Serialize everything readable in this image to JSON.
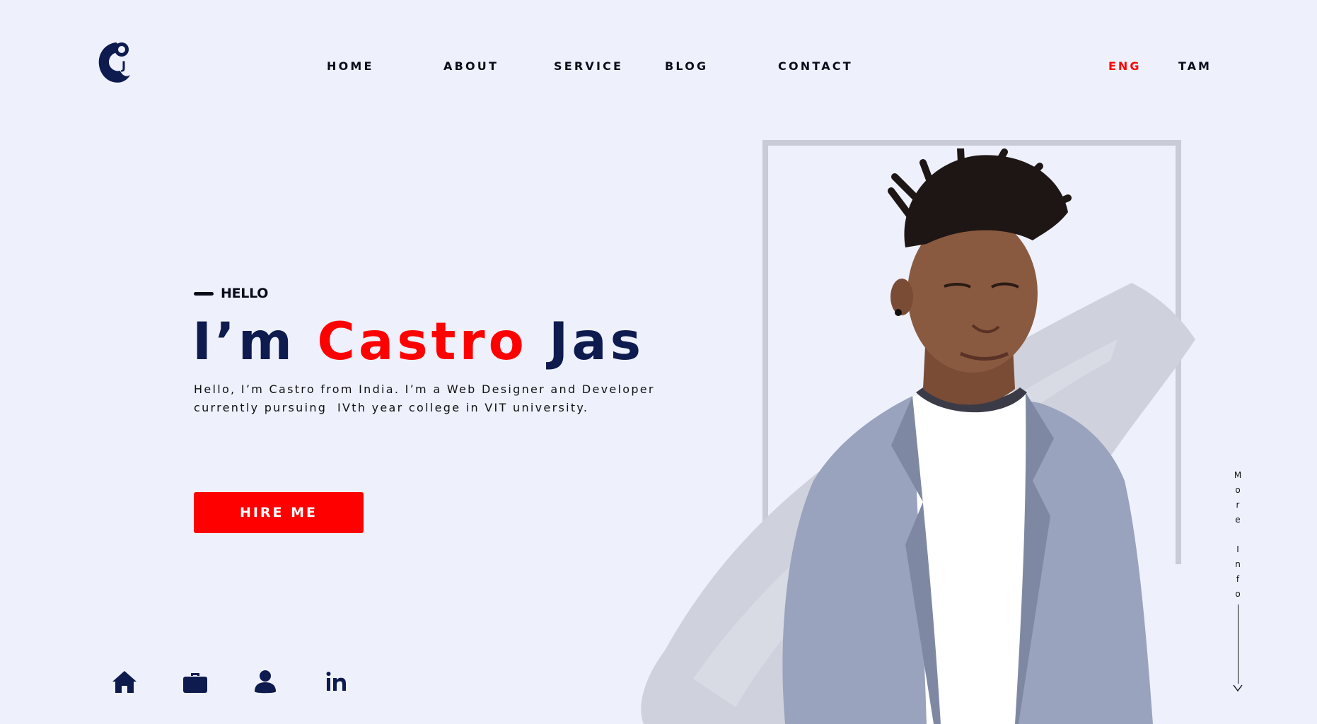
{
  "brand": {
    "logo_letters": "CJ",
    "colors": {
      "navy": "#0d1b4e",
      "red": "#ff0000",
      "background": "#eef1fc"
    }
  },
  "nav": {
    "items": [
      "HOME",
      "ABOUT",
      "SERVICE",
      "BLOG",
      "CONTACT"
    ]
  },
  "lang": {
    "active": "ENG",
    "other": "TAM",
    "active_color": "#ff0000"
  },
  "hero": {
    "eyebrow": "HELLO",
    "headline_prefix": "I’m",
    "headline_accent": "Castro",
    "headline_suffix": "Jas",
    "intro_line1": "Hello, I’m Castro from India. I’m a Web Designer and Developer",
    "intro_line2": "currently pursuing  IVth year college in VIT university.",
    "cta_label": "HIRE ME"
  },
  "bottom_icons": [
    "home-icon",
    "briefcase-icon",
    "user-icon",
    "linkedin-icon"
  ],
  "side": {
    "more_info_letters": [
      "M",
      "o",
      "r",
      "e",
      "",
      "I",
      "n",
      "f",
      "o"
    ]
  }
}
